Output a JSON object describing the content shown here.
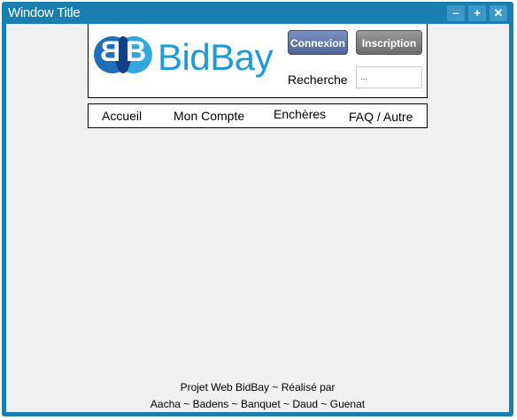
{
  "window": {
    "title": "Window Title",
    "minimize_label": "–",
    "maximize_label": "+",
    "close_label": "✕"
  },
  "logo": {
    "letter_left": "B",
    "letter_right": "B",
    "text": "BidBay"
  },
  "header": {
    "login_label": "Connexion",
    "signup_label": "Inscription",
    "search_label": "Recherche",
    "search_value": "..."
  },
  "nav": {
    "items": [
      "Accueil",
      "Mon Compte",
      "Enchères",
      "FAQ / Autre"
    ]
  },
  "footer": {
    "line1": "Projet Web BidBay ~ Réalisé par",
    "line2": "Aacha ~ Badens ~ Banquet ~ Daud ~ Guenat"
  },
  "colors": {
    "window_frame": "#1a7fae",
    "brand_blue": "#1e9ad6",
    "login_button": "#5e76a8",
    "signup_button": "#7f7f7f"
  }
}
